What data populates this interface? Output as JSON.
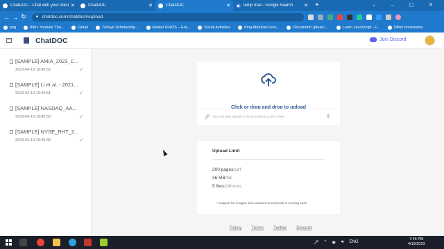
{
  "browser": {
    "tabs": [
      {
        "title": "ChatDOC - Chat with your docum"
      },
      {
        "title": "ChatDOC"
      },
      {
        "title": "ChatDOC"
      },
      {
        "title": "temp mail - Google Search"
      }
    ],
    "url": "chatdoc.com/chatdoc/#/upload",
    "bookmarks": [
      "png",
      "890+ Youtube Thu...",
      "Gmail",
      "Türkiye Scholarship...",
      "Master IFROS – Era...",
      "Social Activities",
      "King Abdullah Univ...",
      "Document Upload |...",
      "Learn JavaScript - F...",
      "Other bookmarks"
    ]
  },
  "header": {
    "brand": "ChatDOC",
    "discord_label": "Join Discord"
  },
  "sidebar": {
    "documents": [
      {
        "name": "[SAMPLE] AMIA_2023_C...",
        "date": "2023-04-19 19:45:52"
      },
      {
        "name": "[SAMPLE] Li et al. - 2021...",
        "date": "2023-04-19 19:45:51"
      },
      {
        "name": "[SAMPLE] NASDAQ_AA...",
        "date": "2023-04-19 19:45:50"
      },
      {
        "name": "[SAMPLE] NYSE_RHT_2...",
        "date": "2023-04-19 19:45:49"
      }
    ]
  },
  "upload": {
    "prompt": "Click or drag and drop to upload",
    "url_hint": "You can also upload a file by pasting a URL here"
  },
  "limits": {
    "title": "Upload Limit",
    "items": [
      {
        "value": "200 pages",
        "unit": "/pdf"
      },
      {
        "value": "36 MB",
        "unit": "/file"
      },
      {
        "value": "5 files",
        "unit": "/24hours"
      }
    ],
    "note": "Support for images and scanned documents is coming soon"
  },
  "footer": {
    "links": [
      "Policy",
      "Terms",
      "Twitter",
      "Discord"
    ]
  },
  "taskbar": {
    "language": "ENG",
    "time": "7:46 PM",
    "date": "4/19/2023"
  },
  "colors": {
    "browser_chrome": "#1f7acd",
    "brand_text": "#2b3a55",
    "upload_blue": "#2d5a95",
    "discord": "#5865f2",
    "check_green": "#6bbf4e"
  }
}
